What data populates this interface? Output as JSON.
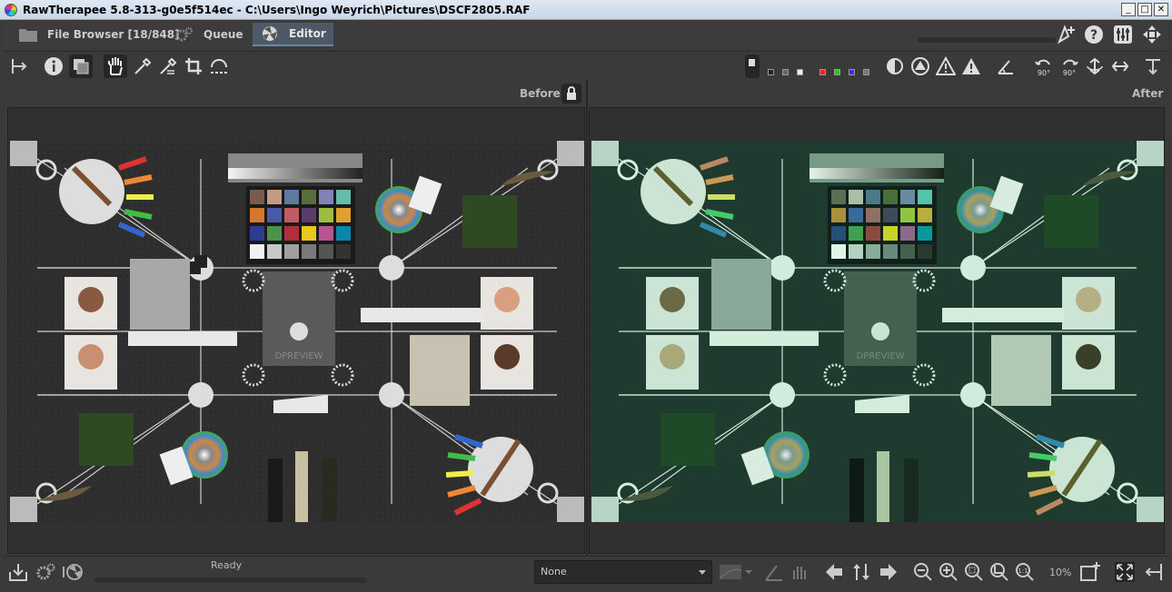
{
  "window": {
    "title": "RawTherapee 5.8-313-g0e5f514ec - C:\\Users\\Ingo Weyrich\\Pictures\\DSCF2805.RAF",
    "min_glyph": "_",
    "max_glyph": "□",
    "close_glyph": "✕"
  },
  "tabs": [
    {
      "label": "File Browser [18/848]",
      "icon": "folder-icon",
      "active": false
    },
    {
      "label": "Queue",
      "icon": "gears-icon",
      "active": false
    },
    {
      "label": "Editor",
      "icon": "aperture-icon",
      "active": true
    }
  ],
  "preview": {
    "before_label": "Before",
    "after_label": "After"
  },
  "statusbar": {
    "status_text": "Ready",
    "profile_combo_value": "None",
    "zoom_level": "10%"
  },
  "colors": {
    "accent": "#6a86a6",
    "panel": "#3a3a3a",
    "after_tint": "#1f3a2e"
  }
}
